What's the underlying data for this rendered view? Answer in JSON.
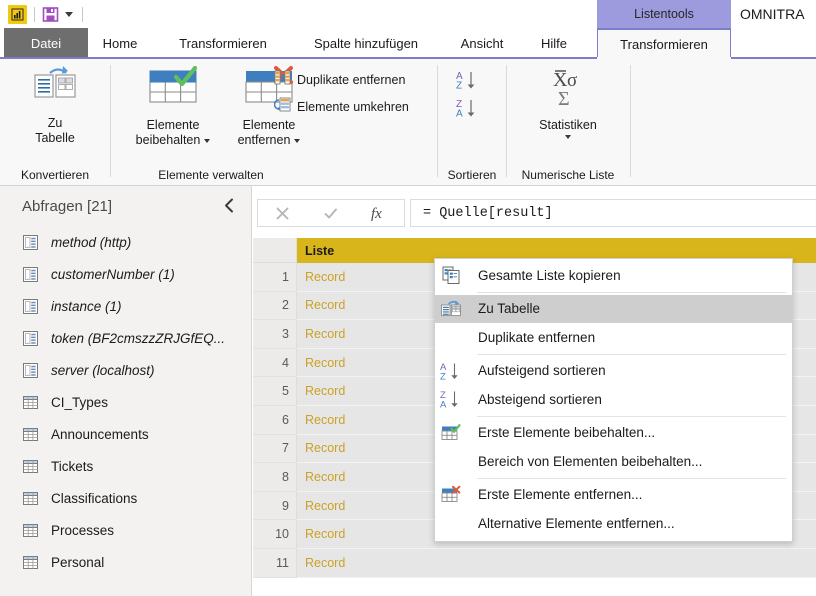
{
  "titlebar": {
    "app_icon": "powerbi-logo-icon",
    "save_icon": "save-icon",
    "save_dropdown_icon": "chevron-down-icon",
    "contextual_tab_group": "Listentools",
    "document_title": "OMNITRA"
  },
  "tabs": [
    {
      "label": "Datei",
      "name": "tab-datei",
      "state": "file"
    },
    {
      "label": "Home",
      "name": "tab-home",
      "state": "normal"
    },
    {
      "label": "Transformieren",
      "name": "tab-transformieren",
      "state": "normal"
    },
    {
      "label": "Spalte hinzufügen",
      "name": "tab-spalte-hinzufuegen",
      "state": "normal"
    },
    {
      "label": "Ansicht",
      "name": "tab-ansicht",
      "state": "normal"
    },
    {
      "label": "Hilfe",
      "name": "tab-hilfe",
      "state": "normal"
    },
    {
      "label": "Transformieren",
      "name": "tab-listentools-transformieren",
      "state": "active"
    }
  ],
  "ribbon": {
    "groups": [
      {
        "label": "Konvertieren",
        "name": "ribbon-group-konvertieren"
      },
      {
        "label": "Elemente verwalten",
        "name": "ribbon-group-elemente-verwalten"
      },
      {
        "label": "Sortieren",
        "name": "ribbon-group-sortieren"
      },
      {
        "label": "Numerische Liste",
        "name": "ribbon-group-numerische-liste"
      }
    ],
    "to_table": {
      "line1": "Zu",
      "line2": "Tabelle",
      "icon": "to-table-icon"
    },
    "keep_items": {
      "line1": "Elemente",
      "line2": "beibehalten",
      "icon": "keep-items-icon",
      "has_dropdown": true
    },
    "remove_items": {
      "line1": "Elemente",
      "line2": "entfernen",
      "icon": "remove-items-icon",
      "has_dropdown": true
    },
    "remove_duplicates": {
      "label": "Duplikate entfernen",
      "icon": "remove-duplicates-icon"
    },
    "reverse_items": {
      "label": "Elemente umkehren",
      "icon": "reverse-items-icon"
    },
    "sort_asc": {
      "icon": "sort-ascending-icon",
      "tooltip": "Aufsteigend sortieren"
    },
    "sort_desc": {
      "icon": "sort-descending-icon",
      "tooltip": "Absteigend sortieren"
    },
    "statistics": {
      "label": "Statistiken",
      "icon": "statistics-sigma-icon",
      "has_dropdown": true
    }
  },
  "queries_pane": {
    "title": "Abfragen [21]",
    "collapse_icon": "chevron-left-icon",
    "items": [
      {
        "label": "method (http)",
        "icon": "parameter-icon",
        "type": "parameter"
      },
      {
        "label": "customerNumber (1)",
        "icon": "parameter-icon",
        "type": "parameter"
      },
      {
        "label": "instance (1)",
        "icon": "parameter-icon",
        "type": "parameter"
      },
      {
        "label": "token (BF2cmszzZRJGfEQ...",
        "icon": "parameter-icon",
        "type": "parameter"
      },
      {
        "label": "server (localhost)",
        "icon": "parameter-icon",
        "type": "parameter"
      },
      {
        "label": "CI_Types",
        "icon": "table-icon",
        "type": "table"
      },
      {
        "label": "Announcements",
        "icon": "table-icon",
        "type": "table"
      },
      {
        "label": "Tickets",
        "icon": "table-icon",
        "type": "table"
      },
      {
        "label": "Classifications",
        "icon": "table-icon",
        "type": "table"
      },
      {
        "label": "Processes",
        "icon": "table-icon",
        "type": "table"
      },
      {
        "label": "Personal",
        "icon": "table-icon",
        "type": "table"
      }
    ]
  },
  "formula_bar": {
    "cancel_icon": "close-icon",
    "accept_icon": "check-icon",
    "fx_icon": "fx-icon",
    "value": "= Quelle[result]"
  },
  "data_grid": {
    "column_header": "Liste",
    "rows": [
      {
        "n": "1",
        "value": "Record"
      },
      {
        "n": "2",
        "value": "Record"
      },
      {
        "n": "3",
        "value": "Record"
      },
      {
        "n": "4",
        "value": "Record"
      },
      {
        "n": "5",
        "value": "Record"
      },
      {
        "n": "6",
        "value": "Record"
      },
      {
        "n": "7",
        "value": "Record"
      },
      {
        "n": "8",
        "value": "Record"
      },
      {
        "n": "9",
        "value": "Record"
      },
      {
        "n": "10",
        "value": "Record"
      },
      {
        "n": "11",
        "value": "Record"
      }
    ]
  },
  "context_menu": {
    "items": [
      {
        "label": "Gesamte Liste kopieren",
        "icon": "copy-icon",
        "selected": false,
        "sep_after": true
      },
      {
        "label": "Zu Tabelle",
        "icon": "to-table-icon",
        "selected": true,
        "sep_after": false
      },
      {
        "label": "Duplikate entfernen",
        "icon": null,
        "selected": false,
        "sep_after": true
      },
      {
        "label": "Aufsteigend sortieren",
        "icon": "sort-ascending-icon",
        "selected": false,
        "sep_after": false
      },
      {
        "label": "Absteigend sortieren",
        "icon": "sort-descending-icon",
        "selected": false,
        "sep_after": true
      },
      {
        "label": "Erste Elemente beibehalten...",
        "icon": "keep-items-icon",
        "selected": false,
        "sep_after": false
      },
      {
        "label": "Bereich von Elementen beibehalten...",
        "icon": null,
        "selected": false,
        "sep_after": true
      },
      {
        "label": "Erste Elemente entfernen...",
        "icon": "remove-items-icon",
        "selected": false,
        "sep_after": false
      },
      {
        "label": "Alternative Elemente entfernen...",
        "icon": null,
        "selected": false,
        "sep_after": false
      }
    ]
  },
  "colors": {
    "pbi_yellow": "#F2C811",
    "contextual_purple": "#9D9BDD",
    "contextual_border": "#7D7CC8",
    "column_header_gold": "#D9B51C",
    "record_text": "#C9A227",
    "file_tab_gray": "#6E6E6E",
    "pane_bg": "#F3F2F1",
    "ribbon_bg": "#F8F8F8"
  }
}
